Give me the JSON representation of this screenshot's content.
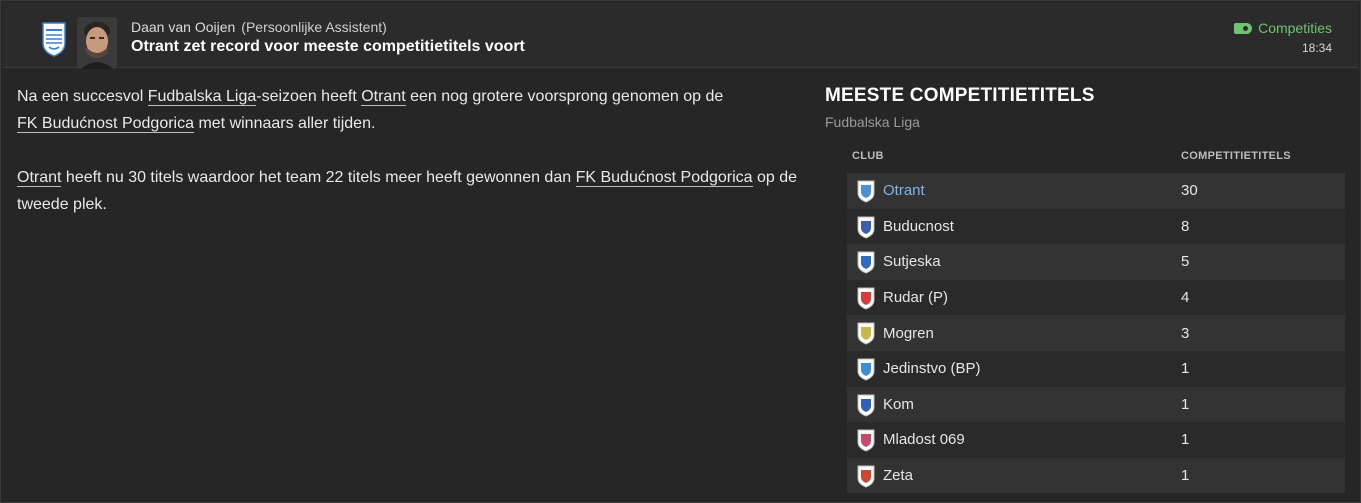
{
  "header": {
    "sender_name": "Daan van Ooijen",
    "sender_role": "(Persoonlijke Assistent)",
    "subject": "Otrant zet record voor meeste competitietitels voort",
    "category": "Competities",
    "time": "18:34"
  },
  "body": {
    "p1": {
      "t1": "Na een succesvol ",
      "l1": "Fudbalska Liga",
      "t2": "-seizoen heeft ",
      "l2": "Otrant",
      "t3": " een nog grotere voorsprong genomen op de ",
      "l3": "FK Budućnost Podgorica",
      "t4": " met winnaars aller tijden."
    },
    "p2": {
      "l1": "Otrant",
      "t1": " heeft nu 30 titels waardoor het team 22 titels meer heeft gewonnen dan ",
      "l2": "FK Budućnost Podgorica",
      "t2": " op de tweede plek."
    }
  },
  "panel": {
    "title": "MEESTE COMPETITIETITELS",
    "subtitle": "Fudbalska Liga",
    "col_club": "CLUB",
    "col_titles": "COMPETITIETITELS",
    "rows": [
      {
        "club": "Otrant",
        "titles": "30",
        "crest_color": "#4a90d9"
      },
      {
        "club": "Buducnost",
        "titles": "8",
        "crest_color": "#3a5fb0"
      },
      {
        "club": "Sutjeska",
        "titles": "5",
        "crest_color": "#2d6cc0"
      },
      {
        "club": "Rudar (P)",
        "titles": "4",
        "crest_color": "#d93a3a"
      },
      {
        "club": "Mogren",
        "titles": "3",
        "crest_color": "#c8b84a"
      },
      {
        "club": "Jedinstvo (BP)",
        "titles": "1",
        "crest_color": "#3b8fd6"
      },
      {
        "club": "Kom",
        "titles": "1",
        "crest_color": "#2f5fb8"
      },
      {
        "club": "Mladost 069",
        "titles": "1",
        "crest_color": "#c84a6a"
      },
      {
        "club": "Zeta",
        "titles": "1",
        "crest_color": "#d0452f"
      }
    ]
  }
}
